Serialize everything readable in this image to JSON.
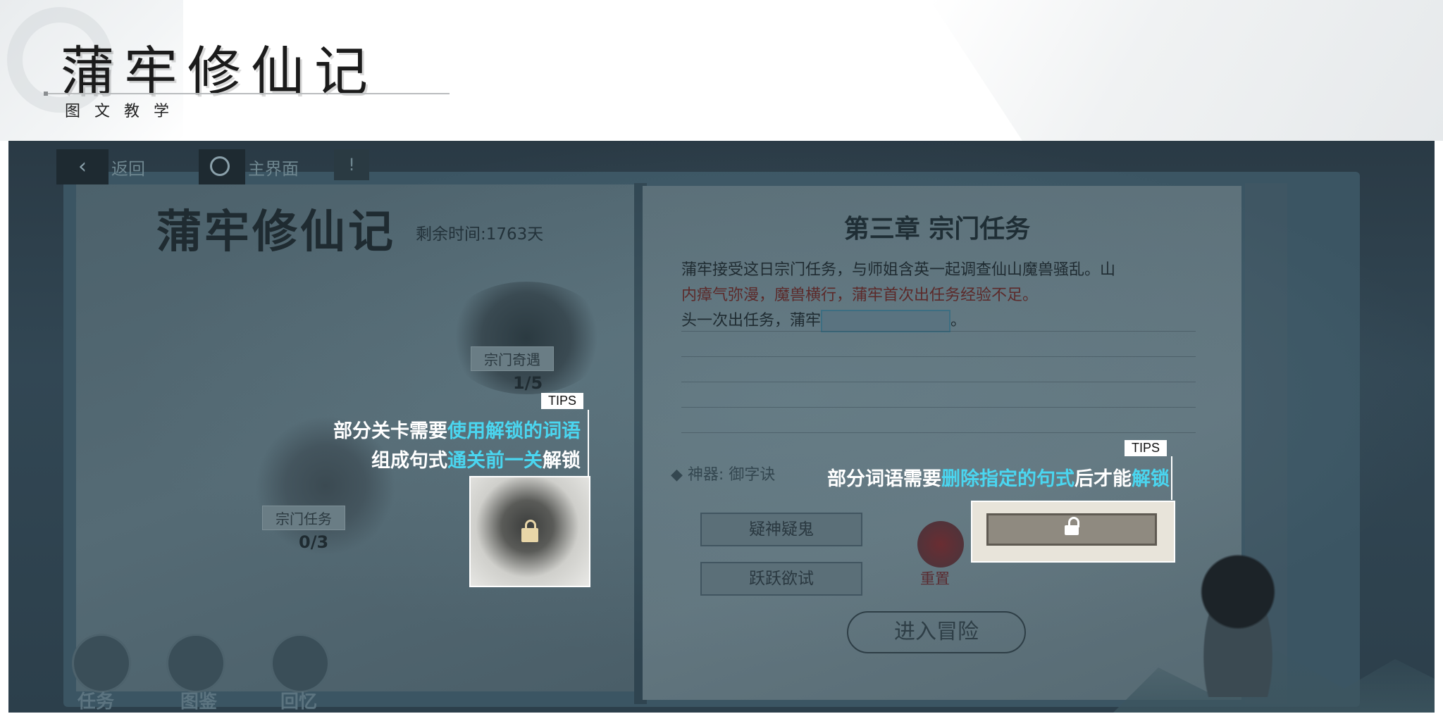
{
  "header": {
    "title": "蒲牢修仙记",
    "subtitle": "图文教学"
  },
  "topbar": {
    "back_icon": "‹",
    "back_label": "返回",
    "home_label": "主界面",
    "info_icon": "!"
  },
  "left_page": {
    "logo": "蒲牢修仙记",
    "remaining_time": "剩余时间:1763天",
    "nodes": [
      {
        "label": "宗门奇遇",
        "count": "1/5"
      },
      {
        "label": "宗门任务",
        "count": "0/3"
      }
    ],
    "bottom_buttons": [
      {
        "label": "任务",
        "icon": "clipboard-icon"
      },
      {
        "label": "图鉴",
        "icon": "book-icon"
      },
      {
        "label": "回忆",
        "icon": "camera-icon"
      }
    ]
  },
  "right_page": {
    "chapter_title": "第三章 宗门任务",
    "story_line1": "蒲牢接受这日宗门任务，与师姐含英一起调查仙山魔兽骚乱。山",
    "story_line2": "内瘴气弥漫，魔兽横行，蒲牢首次出任务经验不足。",
    "story_line3_prefix": "头一次出任务，蒲牢",
    "story_line3_suffix": "。",
    "artifact_label": "◆ 神器: 御字诀",
    "word_buttons": [
      "疑神疑鬼",
      "跃跃欲试"
    ],
    "reset_label": "重置",
    "enter_button": "进入冒险"
  },
  "tips": [
    {
      "tag": "TIPS",
      "line1_prefix": "部分关卡需要",
      "line1_highlight": "使用解锁的词语",
      "line2_prefix": "组成句式",
      "line2_highlight": "通关前一关",
      "line2_suffix": "解锁"
    },
    {
      "tag": "TIPS",
      "prefix": "部分词语需要",
      "highlight1": "删除指定的句式",
      "middle": "后才能",
      "highlight2": "解锁"
    }
  ],
  "colors": {
    "highlight": "#4ad6f0",
    "overlay_text": "#ffffff"
  }
}
